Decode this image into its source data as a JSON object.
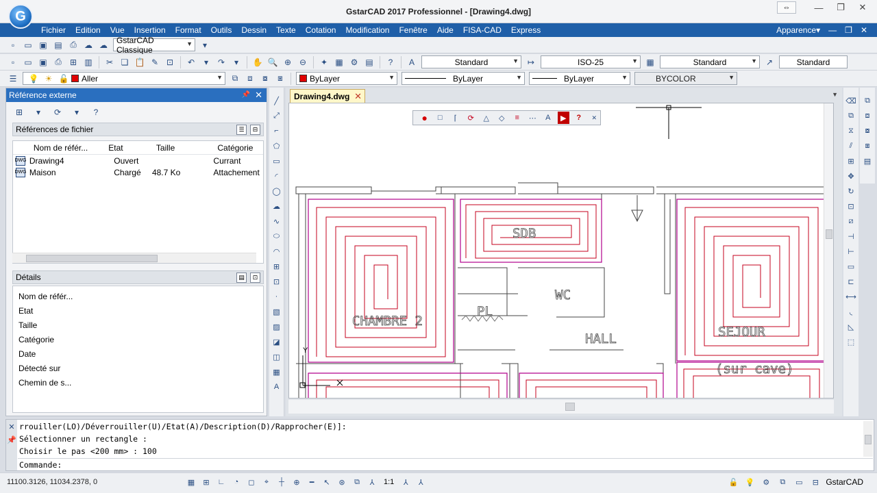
{
  "window": {
    "title": "GstarCAD 2017 Professionnel - [Drawing4.dwg]",
    "logo_letter": "G"
  },
  "menu": {
    "items": [
      "Fichier",
      "Edition",
      "Vue",
      "Insertion",
      "Format",
      "Outils",
      "Dessin",
      "Texte",
      "Cotation",
      "Modification",
      "Fenêtre",
      "Aide",
      "FISA-CAD",
      "Express"
    ],
    "right_label": "Apparence"
  },
  "toolbar1": {
    "workspace": "GstarCAD Classique"
  },
  "toolbar2": {
    "text_style": "Standard",
    "dim_style": "ISO-25",
    "table_style": "Standard",
    "multileader_style": "Standard"
  },
  "toolbar3": {
    "layer": "Aller",
    "color": "ByLayer",
    "linetype": "ByLayer",
    "lineweight": "ByLayer",
    "plotstyle": "BYCOLOR"
  },
  "colors": {
    "accent": "#1f5fa8",
    "panel_title": "#2a6fbf",
    "layer_red": "#e00000",
    "hatch_magenta": "#b0008c",
    "hatch_red": "#c4001e"
  },
  "xref_panel": {
    "title": "Référence externe",
    "file_refs_title": "Références de fichier",
    "columns": [
      "Nom de référ...",
      "Etat",
      "Taille",
      "Catégorie"
    ],
    "rows": [
      {
        "name": "Drawing4",
        "state": "Ouvert",
        "size": "",
        "category": "Currant"
      },
      {
        "name": "Maison",
        "state": "Chargé",
        "size": "48.7 Ko",
        "category": "Attachement"
      }
    ],
    "details_title": "Détails",
    "details": [
      "Nom de référ...",
      "Etat",
      "Taille",
      "Catégorie",
      "Date",
      "Détecté sur",
      "Chemin de s..."
    ]
  },
  "document": {
    "tab": "Drawing4.dwg",
    "room_labels": {
      "sdb": "SDB",
      "wc": "WC",
      "pl": "PL",
      "chambre": "CHAMBRE 2",
      "hall": "HALL",
      "sejour": "SEJOUR",
      "cave": "(sur cave)"
    },
    "ucs_y": "Y"
  },
  "command": {
    "history": [
      "rrouiller(LO)/Déverrouiller(U)/Etat(A)/Description(D)/Rapprocher(E)]:",
      "Sélectionner un rectangle :",
      "Choisir le pas <200 mm> : 100"
    ],
    "prompt": "Commande:"
  },
  "status": {
    "coordinates": "11100.3126, 11034.2378, 0",
    "scale": "1:1",
    "app_name": "GstarCAD"
  }
}
